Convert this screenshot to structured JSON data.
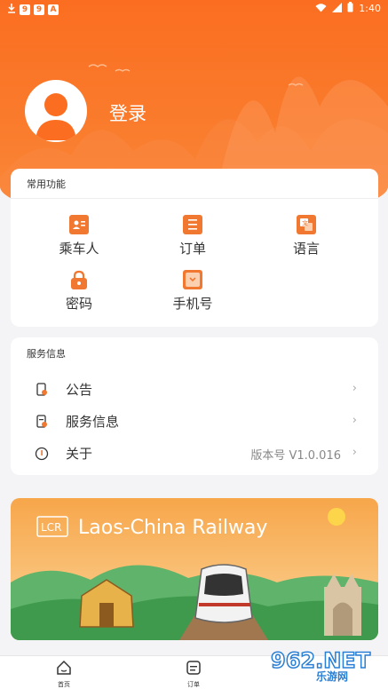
{
  "status_bar": {
    "time": "1:40",
    "icons": [
      "download-icon",
      "app-9-icon",
      "app-9-icon",
      "app-a-icon",
      "wifi-icon",
      "signal-icon",
      "battery-icon"
    ],
    "notif_labels": [
      "9",
      "9",
      "A"
    ]
  },
  "profile": {
    "login_label": "登录"
  },
  "functions": {
    "title": "常用功能",
    "items": [
      {
        "label": "乘车人",
        "icon": "passenger-icon"
      },
      {
        "label": "订单",
        "icon": "order-icon"
      },
      {
        "label": "语言",
        "icon": "language-icon"
      },
      {
        "label": "密码",
        "icon": "lock-icon"
      },
      {
        "label": "手机号",
        "icon": "phone-icon"
      }
    ]
  },
  "service": {
    "title": "服务信息",
    "rows": [
      {
        "label": "公告",
        "value": "",
        "icon": "announcement-icon"
      },
      {
        "label": "服务信息",
        "value": "",
        "icon": "service-info-icon"
      },
      {
        "label": "关于",
        "value": "版本号 V1.0.016",
        "icon": "info-icon"
      }
    ]
  },
  "banner": {
    "logo": "LCR",
    "text": "Laos-China Railway"
  },
  "tabbar": {
    "items": [
      {
        "label": "首页",
        "icon": "home-icon"
      },
      {
        "label": "订单",
        "icon": "order-icon"
      }
    ]
  },
  "watermark": {
    "text": "962.NET",
    "subtext": "乐游网"
  },
  "colors": {
    "accent": "#fb6e21",
    "icon_orange": "#f07830",
    "background": "#f4f4f6"
  }
}
